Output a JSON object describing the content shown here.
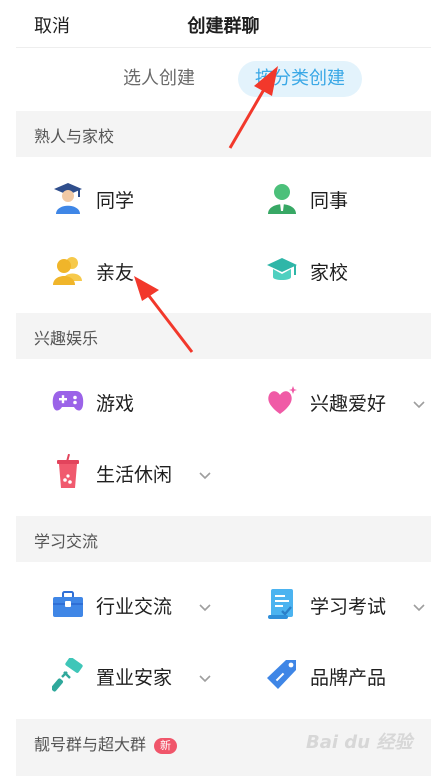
{
  "header": {
    "cancel": "取消",
    "title": "创建群聊"
  },
  "modes": {
    "by_person": "选人创建",
    "by_category": "按分类创建"
  },
  "sections": [
    {
      "title": "熟人与家校",
      "items": [
        {
          "label": "同学",
          "icon": "graduate-icon"
        },
        {
          "label": "同事",
          "icon": "coworker-icon"
        },
        {
          "label": "亲友",
          "icon": "family-friends-icon"
        },
        {
          "label": "家校",
          "icon": "mortarboard-icon"
        }
      ]
    },
    {
      "title": "兴趣娱乐",
      "items": [
        {
          "label": "游戏",
          "icon": "gamepad-icon"
        },
        {
          "label": "兴趣爱好",
          "icon": "heart-sparkle-icon"
        },
        {
          "label": "生活休闲",
          "icon": "bubble-tea-icon"
        }
      ]
    },
    {
      "title": "学习交流",
      "items": [
        {
          "label": "行业交流",
          "icon": "briefcase-icon"
        },
        {
          "label": "学习考试",
          "icon": "exam-scroll-icon"
        },
        {
          "label": "置业安家",
          "icon": "paint-roller-icon"
        },
        {
          "label": "品牌产品",
          "icon": "price-tag-icon"
        }
      ]
    },
    {
      "title": "靓号群与超大群",
      "badge": "新"
    }
  ],
  "watermark": "Bai du 经验",
  "colors": {
    "accent": "#3aa8e6",
    "accent_bg": "#e3f3fc",
    "arrow": "#f2382b",
    "badge": "#f0556a"
  }
}
